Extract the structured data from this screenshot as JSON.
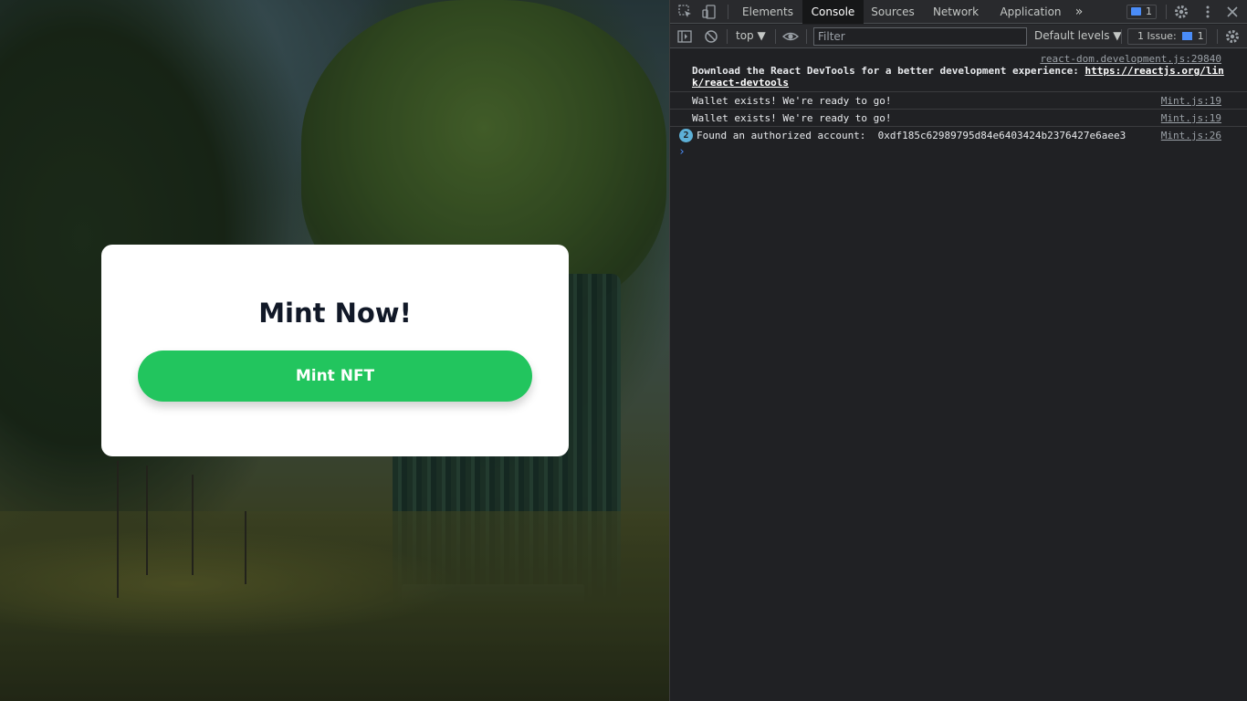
{
  "page": {
    "card_title": "Mint Now!",
    "mint_button_label": "Mint NFT"
  },
  "devtools": {
    "tabs": [
      "Elements",
      "Console",
      "Sources",
      "Network",
      "Application"
    ],
    "active_tab": "Console",
    "more_tabs_glyph": "»",
    "messages_badge": "1",
    "toolbar": {
      "context": "top ▼",
      "filter_placeholder": "Filter",
      "levels": "Default levels ▼",
      "issues_label": "1 Issue:",
      "issues_count": "1"
    },
    "console": [
      {
        "source": "react-dom.development.js:29840",
        "text_line1": "Download the React DevTools for a better development experience: ",
        "link1": "https://reactjs.org/lin",
        "link2": "k/react-devtools"
      },
      {
        "source": "Mint.js:19",
        "text": "Wallet exists! We're ready to go!"
      },
      {
        "source": "Mint.js:19",
        "text": "Wallet exists! We're ready to go!"
      },
      {
        "source": "Mint.js:26",
        "count": "2",
        "text": "Found an authorized account:  0xdf185c62989795d84e6403424b2376427e6aee3"
      }
    ],
    "prompt_glyph": "›"
  }
}
